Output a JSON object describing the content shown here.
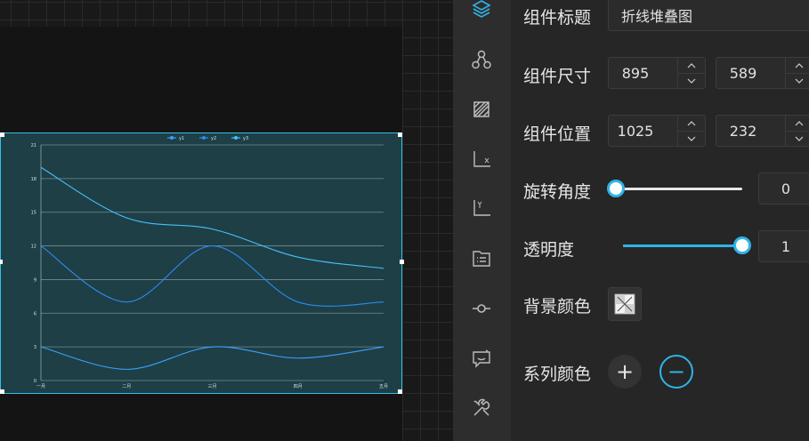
{
  "props": {
    "title_label": "组件标题",
    "title_value": "折线堆叠图",
    "size_label": "组件尺寸",
    "size_width": "895",
    "size_height": "589",
    "position_label": "组件位置",
    "position_x": "1025",
    "position_y": "232",
    "rotation_label": "旋转角度",
    "rotation_value": "0",
    "rotation_fraction": 0,
    "opacity_label": "透明度",
    "opacity_value": "1",
    "opacity_fraction": 1,
    "bg_color_label": "背景颜色",
    "series_color_label": "系列颜色",
    "add_symbol": "+",
    "remove_symbol": "−"
  },
  "rail": {
    "icons": [
      "layers-icon",
      "nodes-icon",
      "shape-icon",
      "x-axis-icon",
      "y-axis-icon",
      "list-icon",
      "line-point-icon",
      "comment-icon",
      "tools-icon"
    ]
  },
  "colors": {
    "accent": "#2fb4e8",
    "series": [
      "#3aa0ff",
      "#2b8cf0",
      "#44c2ff"
    ]
  },
  "chart_data": {
    "type": "line",
    "categories": [
      "一月",
      "二月",
      "三月",
      "四月",
      "五月"
    ],
    "series": [
      {
        "name": "y1",
        "values": [
          3,
          1,
          3,
          2,
          3
        ]
      },
      {
        "name": "y2",
        "values": [
          12,
          7,
          12,
          7,
          7
        ]
      },
      {
        "name": "y3",
        "values": [
          19,
          14.5,
          13.5,
          11,
          10
        ]
      }
    ],
    "yticks": [
      "0",
      "3",
      "6",
      "9",
      "12",
      "15",
      "18",
      "21"
    ],
    "ylim": [
      0,
      21
    ],
    "legend": "top-center",
    "grid": true
  }
}
